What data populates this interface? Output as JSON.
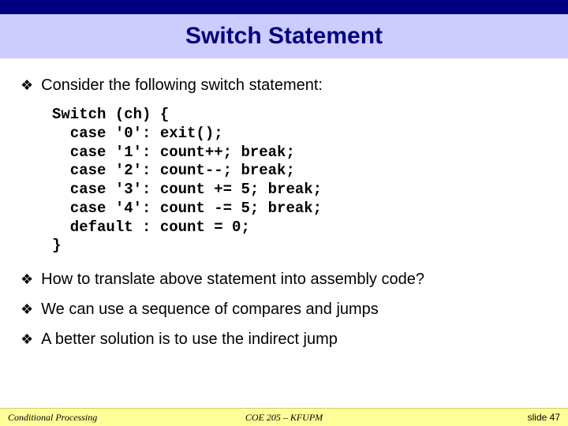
{
  "title": "Switch Statement",
  "bullets": [
    "Consider the following switch statement:",
    "How to translate above statement into assembly code?",
    "We can use a sequence of compares and jumps",
    "A better solution is to use the indirect jump"
  ],
  "code": "Switch (ch) {\n  case '0': exit();\n  case '1': count++; break;\n  case '2': count--; break;\n  case '3': count += 5; break;\n  case '4': count -= 5; break;\n  default : count = 0;\n}",
  "footer": {
    "left": "Conditional Processing",
    "center": "COE 205 – KFUPM",
    "right": "slide 47"
  },
  "bullet_glyph": "❖"
}
